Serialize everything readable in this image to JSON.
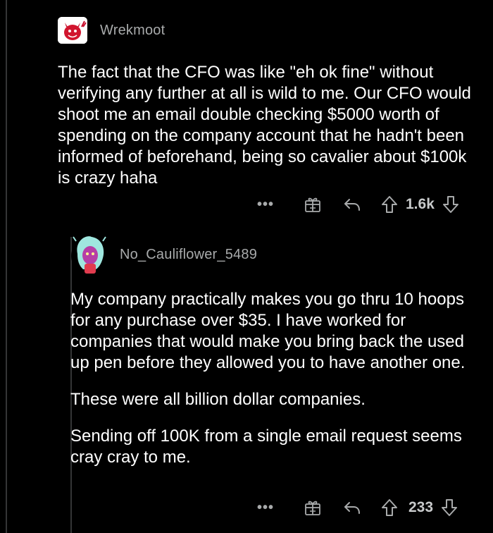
{
  "comments": [
    {
      "username": "Wrekmoot",
      "avatar_icon": "red-devil-avatar-icon",
      "paragraphs": [
        "The fact that the CFO was like \"eh ok fine\" without verifying any further at all is wild to me. Our CFO would shoot me an email double checking $5000 worth of spending on the company account that he hadn't been informed of beforehand, being so cavalier about $100k is crazy haha"
      ],
      "score": "1.6k"
    },
    {
      "username": "No_Cauliflower_5489",
      "avatar_icon": "teal-hair-avatar-icon",
      "paragraphs": [
        "My company practically makes you go thru 10 hoops for any purchase over $35.  I have worked for companies that would make you bring back the used up pen before they allowed you to have another one.",
        "These were all billion dollar companies.",
        "Sending off 100K from a single email request seems cray cray to me."
      ],
      "score": "233"
    }
  ],
  "colors": {
    "background": "#000000",
    "text": "#ffffff",
    "muted": "#a8aaab",
    "thread_line": "#343536"
  }
}
